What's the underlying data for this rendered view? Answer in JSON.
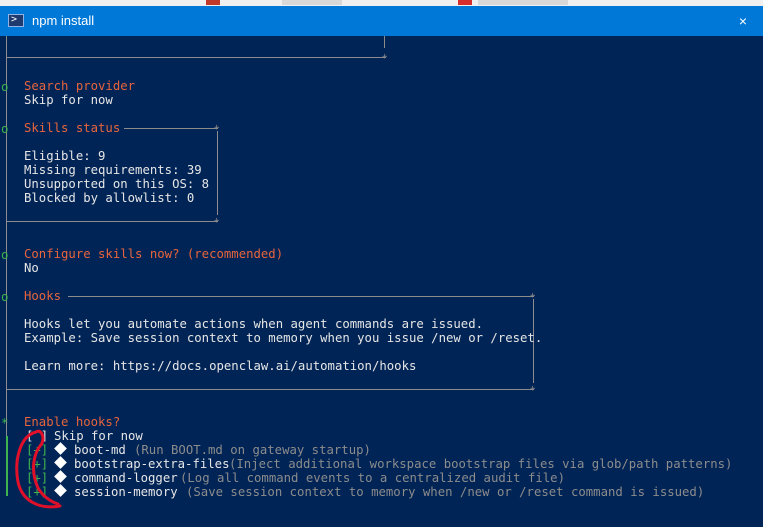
{
  "window": {
    "title": "npm install",
    "close_glyph": "×"
  },
  "sections": {
    "search": {
      "header": "Search provider",
      "value": "Skip for now"
    },
    "skills": {
      "header": "Skills status",
      "lines": [
        "Eligible: 9",
        "Missing requirements: 39",
        "Unsupported on this OS: 8",
        "Blocked by allowlist: 0"
      ]
    },
    "configure": {
      "header": "Configure skills now? (recommended)",
      "value": "No"
    },
    "hooks": {
      "header": "Hooks",
      "lines": [
        "Hooks let you automate actions when agent commands are issued.",
        "Example: Save session context to memory when you issue /new or /reset.",
        "",
        "Learn more: https://docs.openclaw.ai/automation/hooks"
      ]
    },
    "enable": {
      "header": "Enable hooks?",
      "options": [
        {
          "box": "[ ]",
          "name": "Skip for now",
          "desc": ""
        },
        {
          "box": "[+]",
          "name": "boot-md",
          "desc": "(Run BOOT.md on gateway startup)"
        },
        {
          "box": "[+]",
          "name": "bootstrap-extra-files",
          "desc": "(Inject additional workspace bootstrap files via glob/path patterns)"
        },
        {
          "box": "[+]",
          "name": "command-logger",
          "desc": "(Log all command events to a centralized audit file)"
        },
        {
          "box": "[+]",
          "name": "session-memory",
          "desc": "(Save session context to memory when /new or /reset command is issued)"
        }
      ]
    }
  },
  "gutter": {
    "done_marker": "o",
    "active_marker": "*"
  },
  "colors": {
    "background": "#012456",
    "titlebar": "#0078d7",
    "prompt": "#e8643c",
    "text": "#e6e6e6",
    "muted": "#8c8c8c",
    "checked": "#3fb34f",
    "annotation": "#e0102a"
  }
}
